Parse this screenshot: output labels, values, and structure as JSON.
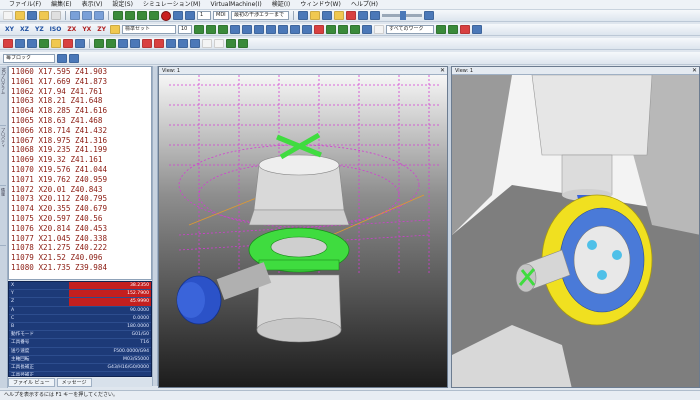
{
  "menu": [
    "ファイル(F)",
    "編集(E)",
    "表示(V)",
    "設定(S)",
    "シミュレーション(M)",
    "VirtualMachine(I)",
    "検証(I)",
    "ウィンドウ(W)",
    "ヘルプ(H)"
  ],
  "toolbar": {
    "speed_value": "1",
    "mode_value": "MDI",
    "run_to_label": "最初の干渉エラーまで",
    "axis_buttons": [
      "XY",
      "XZ",
      "YZ",
      "ISO",
      "ZX",
      "YX",
      "ZY"
    ],
    "view_combo": "標準セット",
    "view_number": "10",
    "workpiece_combo": "すべてのワーク",
    "block_combo": "毎ブロック"
  },
  "nc_program": {
    "lines": [
      {
        "num": "11060",
        "code": "X17.595 Z41.903"
      },
      {
        "num": "11061",
        "code": "X17.669 Z41.873"
      },
      {
        "num": "11062",
        "code": "X17.94 Z41.761"
      },
      {
        "num": "11063",
        "code": "X18.21 Z41.648"
      },
      {
        "num": "11064",
        "code": "X18.285 Z41.616"
      },
      {
        "num": "11065",
        "code": "X18.63 Z41.468"
      },
      {
        "num": "11066",
        "code": "X18.714 Z41.432"
      },
      {
        "num": "11067",
        "code": "X18.975 Z41.316"
      },
      {
        "num": "11068",
        "code": "X19.235 Z41.199"
      },
      {
        "num": "11069",
        "code": "X19.32 Z41.161"
      },
      {
        "num": "11070",
        "code": "X19.576 Z41.044"
      },
      {
        "num": "11071",
        "code": "X19.762 Z40.959"
      },
      {
        "num": "11072",
        "code": "X20.01 Z40.843"
      },
      {
        "num": "11073",
        "code": "X20.112 Z40.795"
      },
      {
        "num": "11074",
        "code": "X20.355 Z40.679"
      },
      {
        "num": "11075",
        "code": "X20.597 Z40.56"
      },
      {
        "num": "11076",
        "code": "X20.814 Z40.453"
      },
      {
        "num": "11077",
        "code": "X21.045 Z40.338"
      },
      {
        "num": "11078",
        "code": "X21.275 Z40.222"
      },
      {
        "num": "11079",
        "code": "X21.52 Z40.096"
      },
      {
        "num": "11080",
        "code": "X21.735 Z39.984"
      }
    ]
  },
  "properties": [
    {
      "key": "X",
      "value": "38.2350",
      "highlight": true
    },
    {
      "key": "Y",
      "value": "152.7900",
      "highlight": true
    },
    {
      "key": "Z",
      "value": "45.9990",
      "highlight": true
    },
    {
      "key": "A",
      "value": "90.0000",
      "highlight": false
    },
    {
      "key": "C",
      "value": "0.0000",
      "highlight": false
    },
    {
      "key": "B",
      "value": "180.0000",
      "highlight": false
    },
    {
      "key": "動作モード",
      "value": "G01/G0",
      "highlight": false
    },
    {
      "key": "工具番号",
      "value": "T16",
      "highlight": false
    },
    {
      "key": "送り速度",
      "value": "F500.0000/G94",
      "highlight": false
    },
    {
      "key": "主軸回転",
      "value": "M03/S5000",
      "highlight": false
    },
    {
      "key": "工具長補正",
      "value": "G43/H16/G0/0000",
      "highlight": false
    },
    {
      "key": "工具径補正",
      "value": "",
      "highlight": false
    },
    {
      "key": "ツールコード",
      "value": "",
      "highlight": false
    }
  ],
  "bottom_tabs": [
    "ファイル ビュー",
    "メッセージ"
  ],
  "viewports": [
    {
      "title": "View: 1"
    },
    {
      "title": "View: 1"
    }
  ],
  "status_text": "ヘルプを表示するには F1 キーを押してください。",
  "colors": {
    "accent": "#3a6fc4",
    "nc_text": "#8a1a10",
    "props_bg": "#1d3a78",
    "highlight_red": "#c41f1f",
    "tool_blue": "#2b52c8",
    "cut_green": "#3fdc3f",
    "path_magenta": "#d23cd2",
    "fixture_yellow": "#f0e020"
  }
}
